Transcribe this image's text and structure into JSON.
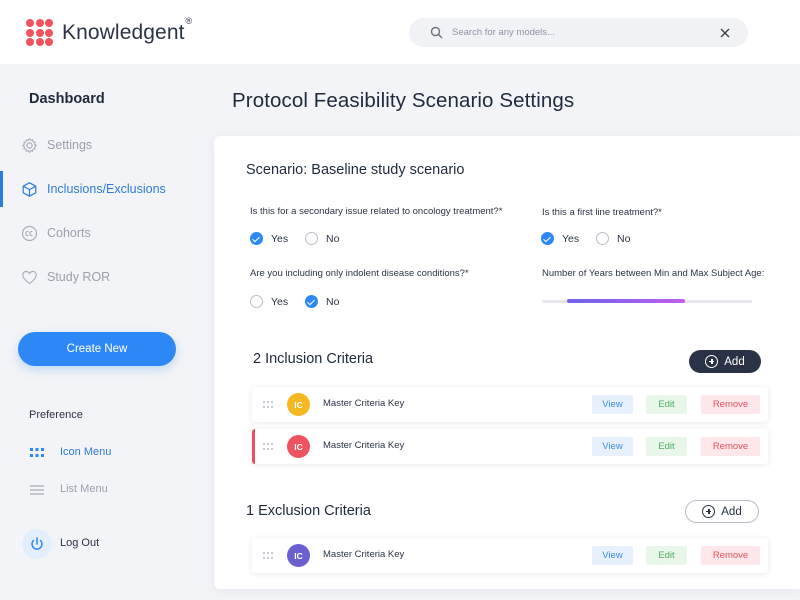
{
  "header": {
    "logo_text": "Knowledgent",
    "logo_reg": "®",
    "search_placeholder": "Search for any models...",
    "search_icon": "search-icon",
    "close_icon": "close-icon"
  },
  "sidebar": {
    "title": "Dashboard",
    "items": [
      {
        "label": "Settings",
        "icon": "gear-icon",
        "active": false
      },
      {
        "label": "Inclusions/Exclusions",
        "icon": "cube-icon",
        "active": true
      },
      {
        "label": "Cohorts",
        "icon": "cc-icon",
        "active": false
      },
      {
        "label": "Study ROR",
        "icon": "heart-icon",
        "active": false
      }
    ],
    "create_label": "Create New",
    "preference_title": "Preference",
    "preferences": [
      {
        "label": "Icon Menu",
        "icon": "grid-icon",
        "active": true
      },
      {
        "label": "List Menu",
        "icon": "list-icon",
        "active": false
      }
    ],
    "logout_label": "Log Out",
    "logout_icon": "power-icon"
  },
  "main": {
    "page_title": "Protocol Feasibility Scenario Settings",
    "scenario_title": "Scenario: Baseline study scenario",
    "questions": [
      {
        "text": "Is this for a secondary issue related to oncology treatment?*",
        "options": [
          "Yes",
          "No"
        ],
        "selected": "Yes"
      },
      {
        "text": "Is this a first line treatment?*",
        "options": [
          "Yes",
          "No"
        ],
        "selected": "Yes"
      },
      {
        "text": "Are you including only indolent disease conditions?*",
        "options": [
          "Yes",
          "No"
        ],
        "selected": "No"
      }
    ],
    "age_range": {
      "label": "Number of Years between Min and Max Subject Age:",
      "start_fraction": 0.12,
      "end_fraction": 0.68
    },
    "inclusion": {
      "title": "2 Inclusion Criteria",
      "add_label": "Add",
      "rows": [
        {
          "badge": "IC",
          "badge_color": "#f5b820",
          "name": "Master Criteria Key",
          "selected": false
        },
        {
          "badge": "IC",
          "badge_color": "#ee5360",
          "name": "Master Criteria Key",
          "selected": true
        }
      ]
    },
    "exclusion": {
      "title": "1 Exclusion Criteria",
      "add_label": "Add",
      "rows": [
        {
          "badge": "IC",
          "badge_color": "#6b5fd1",
          "name": "Master Criteria Key",
          "selected": false
        }
      ]
    },
    "actions": {
      "view": "View",
      "edit": "Edit",
      "remove": "Remove"
    }
  },
  "colors": {
    "accent": "#2d88f5",
    "active_nav": "#2e7cd9",
    "dark_button": "#2a3346",
    "logo": "#f0525e",
    "selected_row_bar": "#ee4f5e"
  }
}
